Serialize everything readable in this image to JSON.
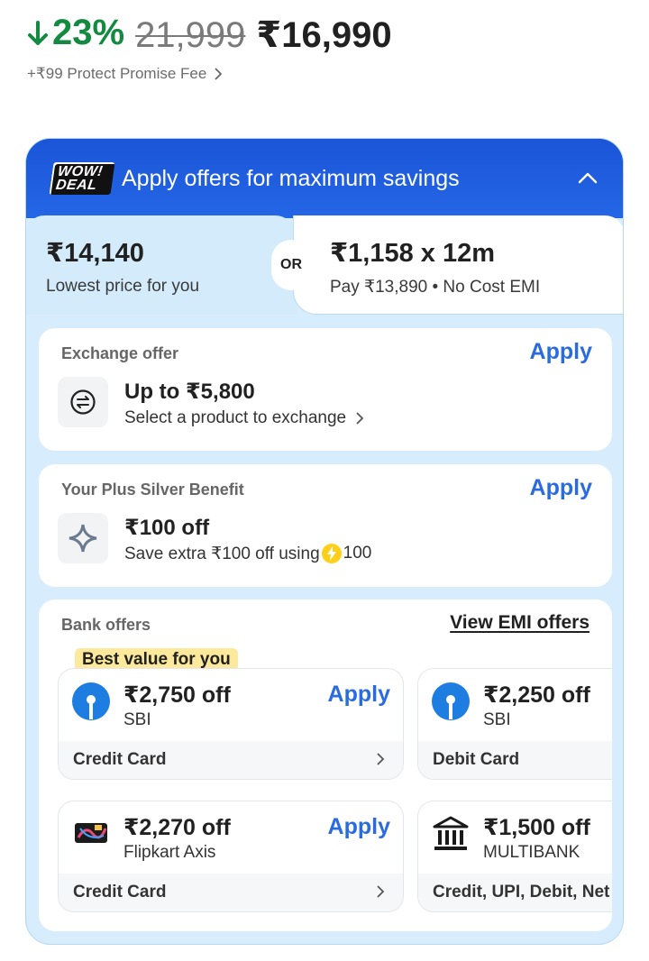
{
  "price": {
    "discount": "23%",
    "mrp": "21,999",
    "final": "₹16,990",
    "fee": "+₹99 Protect Promise Fee"
  },
  "offers": {
    "badge_top": "WOW!",
    "badge_bottom": "DEAL",
    "title": "Apply offers for maximum savings",
    "lowest_price": "₹14,140",
    "lowest_label": "Lowest price for you",
    "or_label": "OR",
    "emi_price": "₹1,158 x 12m",
    "emi_label": "Pay ₹13,890 • No Cost EMI"
  },
  "exchange": {
    "title": "Exchange offer",
    "apply": "Apply",
    "amount": "Up to ₹5,800",
    "sub": "Select a product to exchange"
  },
  "plus": {
    "title": "Your Plus Silver Benefit",
    "apply": "Apply",
    "amount": "₹100 off",
    "sub_prefix": "Save extra ₹100 off using",
    "coins": "100"
  },
  "bank": {
    "title": "Bank offers",
    "emi_link": "View EMI offers",
    "best_badge": "Best value for you",
    "cards": [
      {
        "amount": "₹2,750 off",
        "name": "SBI",
        "type": "Credit Card",
        "apply": "Apply",
        "icon": "sbi-logo-icon"
      },
      {
        "amount": "₹2,250 off",
        "name": "SBI",
        "type": "Debit Card",
        "icon": "sbi-logo-icon"
      },
      {
        "amount": "₹2,270 off",
        "name": "Flipkart Axis",
        "type": "Credit Card",
        "apply": "Apply",
        "icon": "flipkart-axis-card-icon"
      },
      {
        "amount": "₹1,500 off",
        "name": "MULTIBANK",
        "type": "Credit, UPI, Debit, Net",
        "icon": "bank-building-icon"
      }
    ]
  }
}
